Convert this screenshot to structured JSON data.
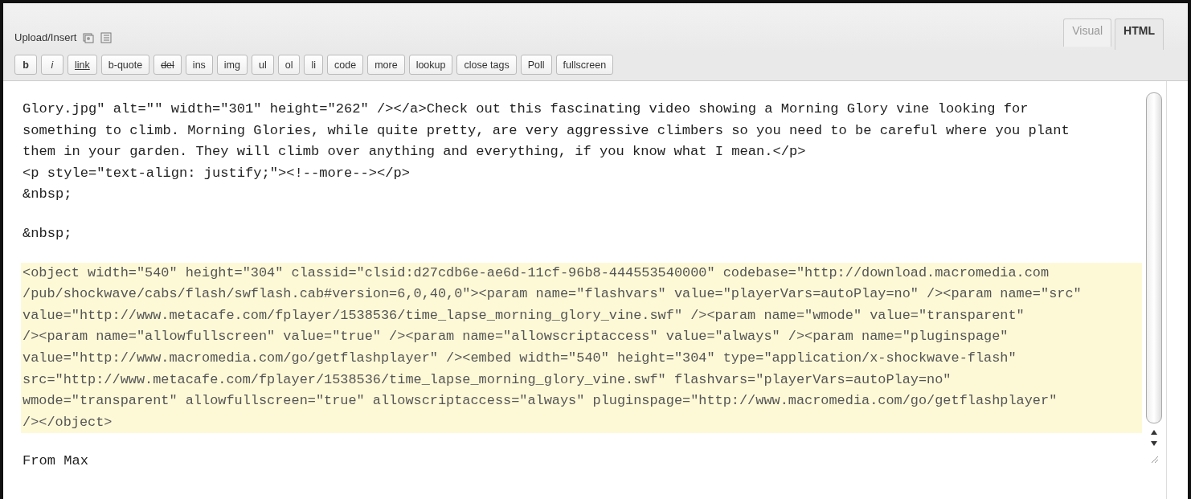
{
  "header": {
    "label": "Upload/Insert"
  },
  "tabs": [
    {
      "label": "Visual",
      "selected": false
    },
    {
      "label": "HTML",
      "selected": true
    }
  ],
  "buttons": [
    {
      "label": "b",
      "kind": "bold"
    },
    {
      "label": "i",
      "kind": "italic"
    },
    {
      "label": "link",
      "kind": "underline"
    },
    {
      "label": "b-quote",
      "kind": "plain"
    },
    {
      "label": "del",
      "kind": "strike"
    },
    {
      "label": "ins",
      "kind": "plain"
    },
    {
      "label": "img",
      "kind": "plain"
    },
    {
      "label": "ul",
      "kind": "plain"
    },
    {
      "label": "ol",
      "kind": "plain"
    },
    {
      "label": "li",
      "kind": "plain"
    },
    {
      "label": "code",
      "kind": "plain"
    },
    {
      "label": "more",
      "kind": "plain"
    },
    {
      "label": "lookup",
      "kind": "plain"
    },
    {
      "label": "close tags",
      "kind": "plain"
    },
    {
      "label": "Poll",
      "kind": "plain"
    },
    {
      "label": "fullscreen",
      "kind": "plain"
    }
  ],
  "editor": {
    "blocks": [
      {
        "kind": "plain",
        "lines": [
          "Glory.jpg\" alt=\"\" width=\"301\" height=\"262\" /></a>Check out this fascinating video showing a Morning Glory vine looking for",
          "something to climb. Morning Glories, while quite pretty, are very aggressive climbers so you need to be careful where you plant",
          "them in your garden. They will climb over anything and everything, if you know what I mean.</p>",
          "<p style=\"text-align: justify;\"><!--more--></p>",
          "&nbsp;"
        ]
      },
      {
        "kind": "plain",
        "lines": [
          "&nbsp;"
        ]
      },
      {
        "kind": "highlight",
        "lines": [
          "<object width=\"540\" height=\"304\" classid=\"clsid:d27cdb6e-ae6d-11cf-96b8-444553540000\" codebase=\"http://download.macromedia.com",
          "/pub/shockwave/cabs/flash/swflash.cab#version=6,0,40,0\"><param name=\"flashvars\" value=\"playerVars=autoPlay=no\" /><param name=\"src\"",
          "value=\"http://www.metacafe.com/fplayer/1538536/time_lapse_morning_glory_vine.swf\" /><param name=\"wmode\" value=\"transparent\"",
          "/><param name=\"allowfullscreen\" value=\"true\" /><param name=\"allowscriptaccess\" value=\"always\" /><param name=\"pluginspage\"",
          "value=\"http://www.macromedia.com/go/getflashplayer\" /><embed width=\"540\" height=\"304\" type=\"application/x-shockwave-flash\"",
          "src=\"http://www.metacafe.com/fplayer/1538536/time_lapse_morning_glory_vine.swf\" flashvars=\"playerVars=autoPlay=no\"",
          "wmode=\"transparent\" allowfullscreen=\"true\" allowscriptaccess=\"always\" pluginspage=\"http://www.macromedia.com/go/getflashplayer\"",
          "/></object>"
        ]
      },
      {
        "kind": "plain",
        "lines": [
          "From Max"
        ]
      }
    ]
  }
}
